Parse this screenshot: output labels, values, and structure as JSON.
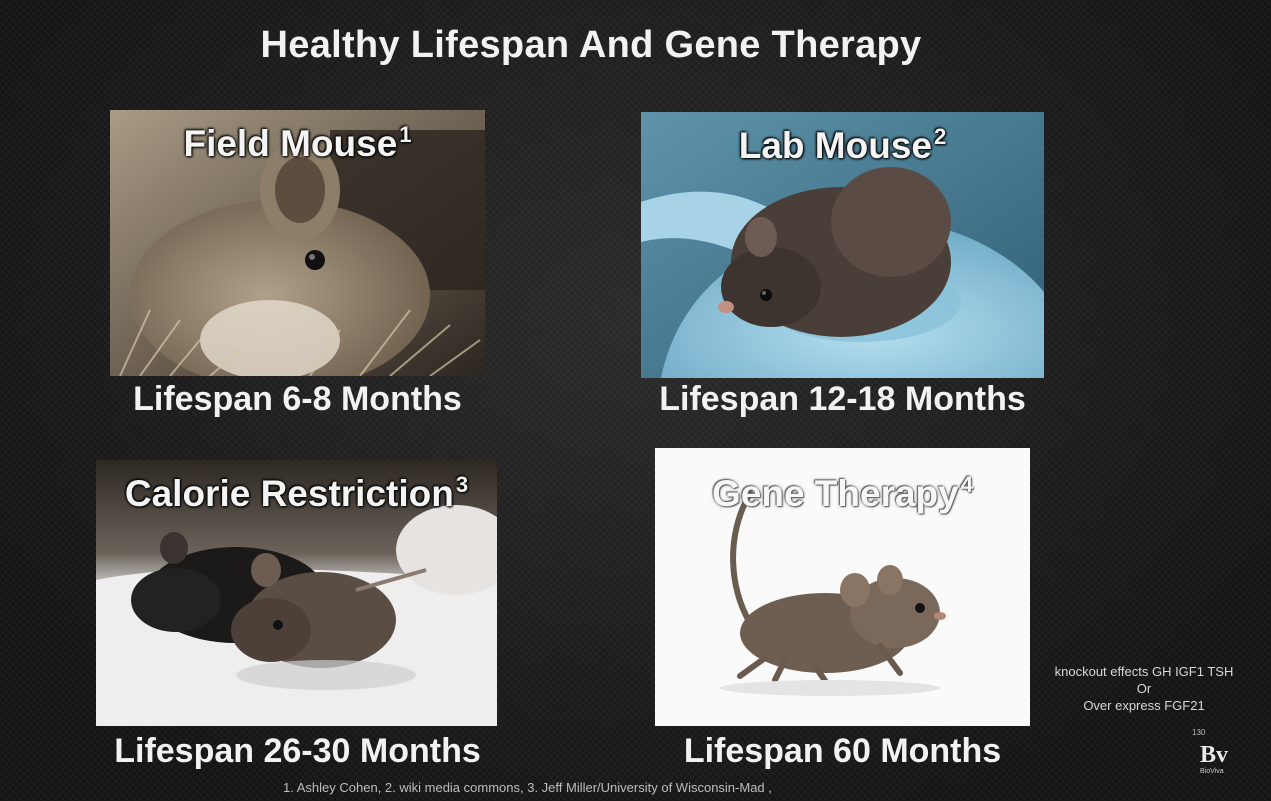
{
  "slide": {
    "title": "Healthy Lifespan And Gene Therapy",
    "panels": [
      {
        "name": "Field Mouse",
        "ref": "1",
        "lifespan": "Lifespan 6-8 Months"
      },
      {
        "name": "Lab Mouse",
        "ref": "2",
        "lifespan": "Lifespan 12-18 Months"
      },
      {
        "name": "Calorie Restriction",
        "ref": "3",
        "lifespan": "Lifespan 26-30 Months"
      },
      {
        "name": "Gene Therapy",
        "ref": "4",
        "lifespan": "Lifespan 60 Months"
      }
    ],
    "note": {
      "line1": "knockout effects GH IGF1 TSH",
      "line2": "Or",
      "line3": "Over express FGF21"
    },
    "footer": "1. Ashley Cohen, 2. wiki media commons, 3. Jeff Miller/University of Wisconsin-Mad ,",
    "logo": {
      "number": "130",
      "mark": "Bv",
      "name": "BioViva"
    }
  }
}
